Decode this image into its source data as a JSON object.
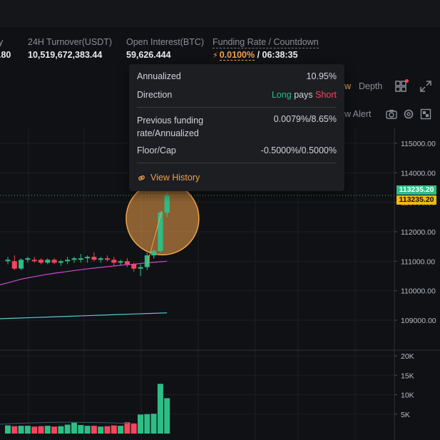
{
  "ticker": {
    "partial_value": ".80",
    "turnover_label": "24H Turnover(USDT)",
    "turnover_value": "10,519,672,383.44",
    "oi_label": "Open Interest(BTC)",
    "oi_value": "59,626.444",
    "funding_label": "Funding Rate / Countdown",
    "funding_rate": "0.0100%",
    "funding_sep": " / ",
    "countdown": "06:38:35"
  },
  "toolbar": {
    "partial_tab": "w",
    "depth_label": "Depth",
    "partial_alert": "ew Alert"
  },
  "tooltip": {
    "annualized_label": "Annualized",
    "annualized_value": "10.95%",
    "direction_label": "Direction",
    "direction_long": "Long",
    "direction_pays": " pays ",
    "direction_short": "Short",
    "prev_label_line1": "Previous funding",
    "prev_label_line2": "rate/Annualized",
    "prev_value": "0.0079%/8.65%",
    "floor_label": "Floor/Cap",
    "floor_value": "-0.5000%/0.5000%",
    "history_label": "View History"
  },
  "price_axis": {
    "labels": [
      "115000.00",
      "114000.00",
      "113000.00",
      "112000.00",
      "111000.00",
      "110000.00",
      "109000.00"
    ],
    "last_price_green": "113235.20",
    "last_price_orange": "113235.20"
  },
  "volume_axis": {
    "labels": [
      "20K",
      "15K",
      "10K",
      "5K"
    ]
  },
  "colors": {
    "up": "#2ebd85",
    "down": "#f6465d",
    "accent": "#f0a24a",
    "ma1": "#d04ad6",
    "ma2": "#5cc8d6"
  },
  "chart_data": {
    "type": "candlestick",
    "price_range": [
      108500,
      115500
    ],
    "volume_range": [
      0,
      20000
    ],
    "last_price": 113235.2,
    "candles": [
      {
        "o": 111000,
        "h": 111150,
        "l": 110900,
        "c": 111050
      },
      {
        "o": 111000,
        "h": 111200,
        "l": 110700,
        "c": 110750
      },
      {
        "o": 110750,
        "h": 111100,
        "l": 110700,
        "c": 111050
      },
      {
        "o": 111050,
        "h": 111150,
        "l": 110950,
        "c": 111100
      },
      {
        "o": 111050,
        "h": 111150,
        "l": 110950,
        "c": 111000
      },
      {
        "o": 111050,
        "h": 111100,
        "l": 110900,
        "c": 110950
      },
      {
        "o": 110950,
        "h": 111100,
        "l": 110900,
        "c": 111050
      },
      {
        "o": 111050,
        "h": 111100,
        "l": 110900,
        "c": 110950
      },
      {
        "o": 110950,
        "h": 111050,
        "l": 110850,
        "c": 111000
      },
      {
        "o": 111000,
        "h": 111150,
        "l": 110900,
        "c": 111050
      },
      {
        "o": 111050,
        "h": 111150,
        "l": 110950,
        "c": 111100
      },
      {
        "o": 111050,
        "h": 111250,
        "l": 110950,
        "c": 111100
      },
      {
        "o": 111100,
        "h": 111200,
        "l": 110950,
        "c": 111150
      },
      {
        "o": 111150,
        "h": 111300,
        "l": 111000,
        "c": 111050
      },
      {
        "o": 111050,
        "h": 111150,
        "l": 110950,
        "c": 111100
      },
      {
        "o": 111100,
        "h": 111200,
        "l": 111000,
        "c": 111050
      },
      {
        "o": 111050,
        "h": 111150,
        "l": 110850,
        "c": 110950
      },
      {
        "o": 110950,
        "h": 111050,
        "l": 110850,
        "c": 111000
      },
      {
        "o": 111000,
        "h": 111100,
        "l": 110800,
        "c": 110900
      },
      {
        "o": 110900,
        "h": 110950,
        "l": 110650,
        "c": 110750
      },
      {
        "o": 110750,
        "h": 110900,
        "l": 110500,
        "c": 110800
      },
      {
        "o": 110800,
        "h": 111300,
        "l": 110700,
        "c": 111200
      },
      {
        "o": 111200,
        "h": 111400,
        "l": 111100,
        "c": 111350
      },
      {
        "o": 111350,
        "h": 112700,
        "l": 111300,
        "c": 112650
      },
      {
        "o": 112650,
        "h": 113300,
        "l": 112500,
        "c": 113235
      }
    ],
    "volumes": [
      2100,
      1900,
      2000,
      2000,
      1800,
      1900,
      2000,
      1800,
      1900,
      2300,
      2800,
      2200,
      2000,
      2000,
      1800,
      1900,
      2100,
      2000,
      2900,
      2600,
      4900,
      5000,
      5100,
      12800,
      9100
    ],
    "ma_short": [
      110200,
      110300,
      110400,
      110470,
      110540,
      110600,
      110650,
      110700,
      110750,
      110790,
      110830,
      110870,
      110900,
      110940,
      110970,
      111000
    ],
    "ma_long": [
      109050,
      109070,
      109090,
      109110,
      109130,
      109150,
      109170,
      109190,
      109210,
      109230,
      109250
    ]
  }
}
